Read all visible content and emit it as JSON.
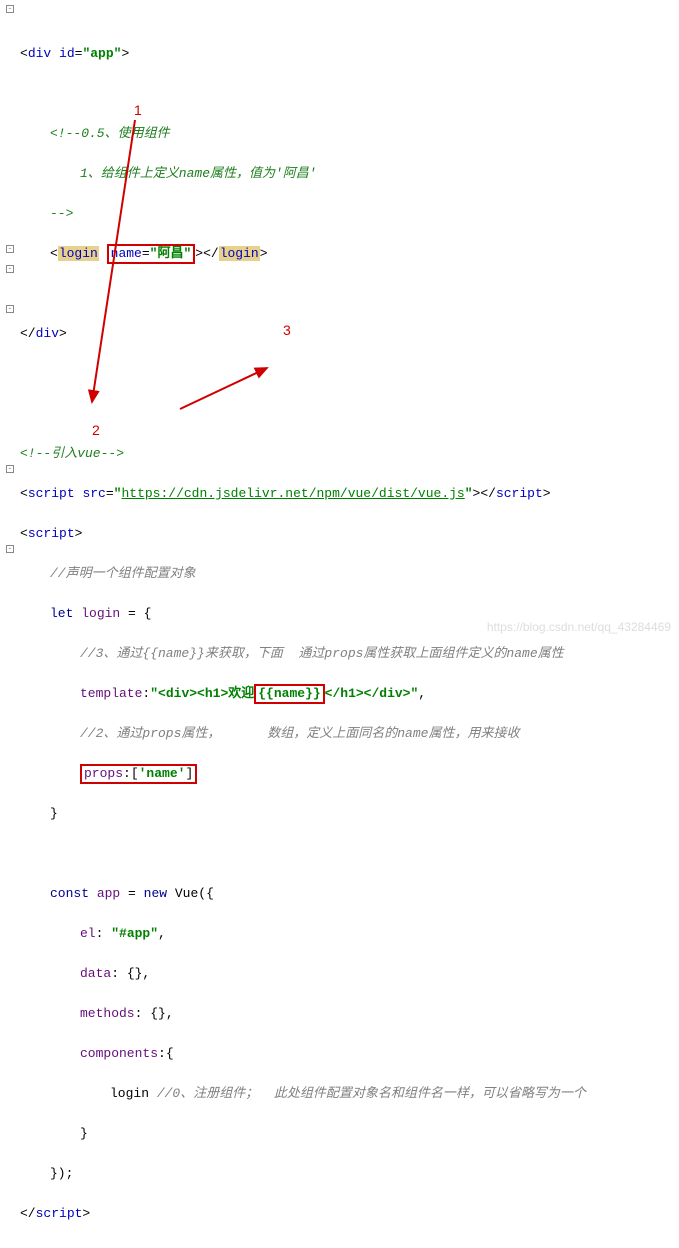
{
  "code": {
    "open_div": "<div id=\"app\">",
    "c1a": "<!--0.5、使用组件",
    "c1b": "1、给组件上定义name属性，值为'阿昌'",
    "c1c": "-->",
    "login_open": "login",
    "name_attr": "name=\"阿昌\"",
    "login_close": "login",
    "close_div": "</div>",
    "c2": "<!--引入vue-->",
    "script_open": "script",
    "src": "src",
    "vue_url": "https://cdn.jsdelivr.net/npm/vue/dist/vue.js",
    "script_close": "script",
    "script2": "script",
    "c3": "//声明一个组件配置对象",
    "let": "let",
    "login_var": "login",
    "c4": "//3、通过{{name}}来获取，下面  通过props属性获取上面组件定义的name属性",
    "template_key": "template",
    "tpl_left": "\"<div><h1>欢迎",
    "tpl_mid": "{{name}}",
    "tpl_right": "</h1></div>\"",
    "c5a": "//2、通过props属性，",
    "c5b": "数组，定义上面同名的name属性，用来接收",
    "props": "props:['name']",
    "const": "const",
    "app": "app",
    "new": "new",
    "Vue": "Vue",
    "el_key": "el",
    "el_val": "\"#app\"",
    "data_key": "data",
    "methods_key": "methods",
    "components_key": "components",
    "reg_login": "login",
    "c6": "//0、注册组件；  此处组件配置对象名和组件名一样，可以省略写为一个",
    "script_end": "script"
  },
  "annotations": {
    "n1": "1",
    "n2": "2",
    "n3": "3"
  },
  "watermark": "https://blog.csdn.net/qq_43284469"
}
